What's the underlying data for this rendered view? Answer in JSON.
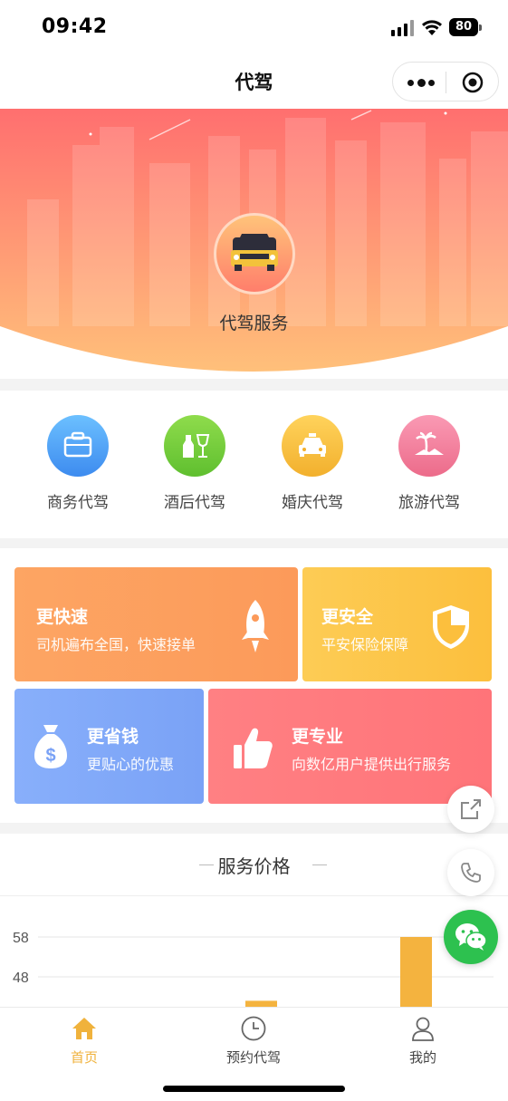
{
  "status_bar": {
    "time": "09:42",
    "battery": "80",
    "signal_icon": "signal-icon",
    "wifi_icon": "wifi-icon"
  },
  "navbar": {
    "title": "代驾",
    "more_icon": "more-dots-icon",
    "close_icon": "target-icon"
  },
  "hero": {
    "label": "代驾服务",
    "icon": "car-icon",
    "colors": {
      "top": "#ff6f6f",
      "bottom": "#ffc07a"
    }
  },
  "categories": [
    {
      "label": "商务代驾",
      "icon": "briefcase-icon",
      "color": "#4aa3f5"
    },
    {
      "label": "酒后代驾",
      "icon": "bottle-glass-icon",
      "color": "#7ed13f"
    },
    {
      "label": "婚庆代驾",
      "icon": "taxi-icon",
      "color": "#f6c542"
    },
    {
      "label": "旅游代驾",
      "icon": "palm-tree-icon",
      "color": "#f07c9a"
    }
  ],
  "features": [
    {
      "title": "更快速",
      "subtitle": "司机遍布全国，快速接单",
      "icon": "rocket-icon",
      "color": "#fca45f"
    },
    {
      "title": "更安全",
      "subtitle": "平安保险保障",
      "icon": "shield-icon",
      "color": "#fdc84a"
    },
    {
      "title": "更省钱",
      "subtitle": "更贴心的优惠",
      "icon": "money-bag-icon",
      "color": "#7ea7f8"
    },
    {
      "title": "更专业",
      "subtitle": "向数亿用户提供出行服务",
      "icon": "thumbs-up-icon",
      "color": "#ff7a7f"
    }
  ],
  "price": {
    "heading": "服务价格"
  },
  "chart_data": {
    "type": "bar",
    "categories": [
      "",
      "",
      ""
    ],
    "values": [
      null,
      42,
      58
    ],
    "tick_labels": [
      "58",
      "48"
    ],
    "bar_color": "#f4b33f",
    "grid": true
  },
  "floating": {
    "share_icon": "share-icon",
    "phone_icon": "phone-icon",
    "wechat_icon": "wechat-icon"
  },
  "tabbar": {
    "items": [
      {
        "label": "首页",
        "icon": "home-icon",
        "active": true
      },
      {
        "label": "预约代驾",
        "icon": "clock-icon",
        "active": false
      },
      {
        "label": "我的",
        "icon": "user-icon",
        "active": false
      }
    ],
    "active_color": "#f0b23c"
  }
}
